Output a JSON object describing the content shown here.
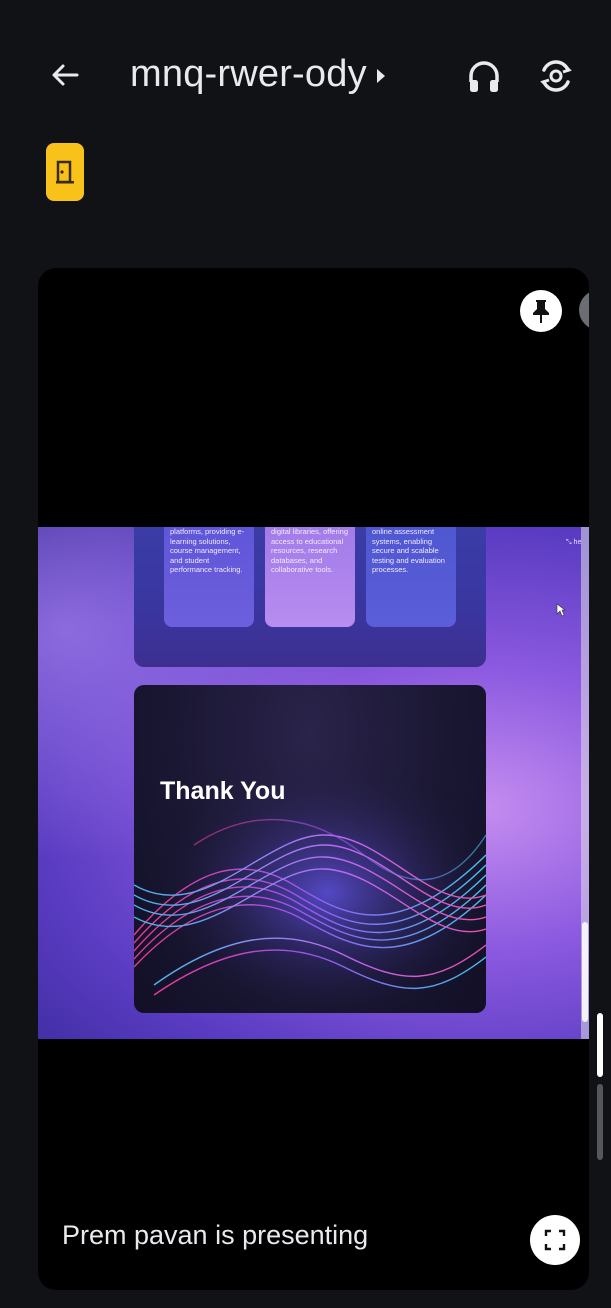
{
  "header": {
    "meeting_code": "mnq-rwer-ody",
    "back_icon": "arrow-left-icon",
    "audio_icon": "headphones-icon",
    "camera_switch_icon": "switch-camera-icon"
  },
  "exit_badge": {
    "icon": "door-exit-icon",
    "color": "#f9c21b"
  },
  "tile": {
    "pin_icon": "pin-icon",
    "mic_icon": "mic-off-icon",
    "presenter_status": "Prem pavan is presenting",
    "fullscreen_icon": "fullscreen-icon"
  },
  "presentation": {
    "cards": [
      {
        "text": "platforms, providing e-learning solutions, course management, and student performance tracking."
      },
      {
        "text": "digital libraries, offering access to educational resources, research databases, and collaborative tools."
      },
      {
        "text": "online assessment systems, enabling secure and scalable testing and evaluation processes."
      }
    ],
    "closing_slide_title": "Thank You",
    "corner_label": "⤡ he"
  },
  "colors": {
    "background": "#111216",
    "tile": "#000000",
    "accent_yellow": "#f9c21b"
  }
}
